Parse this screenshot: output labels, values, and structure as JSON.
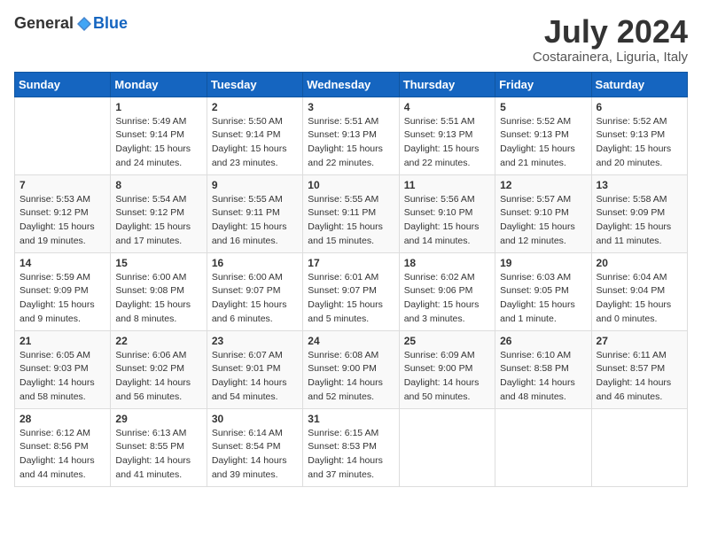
{
  "header": {
    "logo_general": "General",
    "logo_blue": "Blue",
    "title": "July 2024",
    "location": "Costarainera, Liguria, Italy"
  },
  "days_of_week": [
    "Sunday",
    "Monday",
    "Tuesday",
    "Wednesday",
    "Thursday",
    "Friday",
    "Saturday"
  ],
  "weeks": [
    [
      {
        "day": "",
        "info": ""
      },
      {
        "day": "1",
        "info": "Sunrise: 5:49 AM\nSunset: 9:14 PM\nDaylight: 15 hours\nand 24 minutes."
      },
      {
        "day": "2",
        "info": "Sunrise: 5:50 AM\nSunset: 9:14 PM\nDaylight: 15 hours\nand 23 minutes."
      },
      {
        "day": "3",
        "info": "Sunrise: 5:51 AM\nSunset: 9:13 PM\nDaylight: 15 hours\nand 22 minutes."
      },
      {
        "day": "4",
        "info": "Sunrise: 5:51 AM\nSunset: 9:13 PM\nDaylight: 15 hours\nand 22 minutes."
      },
      {
        "day": "5",
        "info": "Sunrise: 5:52 AM\nSunset: 9:13 PM\nDaylight: 15 hours\nand 21 minutes."
      },
      {
        "day": "6",
        "info": "Sunrise: 5:52 AM\nSunset: 9:13 PM\nDaylight: 15 hours\nand 20 minutes."
      }
    ],
    [
      {
        "day": "7",
        "info": "Sunrise: 5:53 AM\nSunset: 9:12 PM\nDaylight: 15 hours\nand 19 minutes."
      },
      {
        "day": "8",
        "info": "Sunrise: 5:54 AM\nSunset: 9:12 PM\nDaylight: 15 hours\nand 17 minutes."
      },
      {
        "day": "9",
        "info": "Sunrise: 5:55 AM\nSunset: 9:11 PM\nDaylight: 15 hours\nand 16 minutes."
      },
      {
        "day": "10",
        "info": "Sunrise: 5:55 AM\nSunset: 9:11 PM\nDaylight: 15 hours\nand 15 minutes."
      },
      {
        "day": "11",
        "info": "Sunrise: 5:56 AM\nSunset: 9:10 PM\nDaylight: 15 hours\nand 14 minutes."
      },
      {
        "day": "12",
        "info": "Sunrise: 5:57 AM\nSunset: 9:10 PM\nDaylight: 15 hours\nand 12 minutes."
      },
      {
        "day": "13",
        "info": "Sunrise: 5:58 AM\nSunset: 9:09 PM\nDaylight: 15 hours\nand 11 minutes."
      }
    ],
    [
      {
        "day": "14",
        "info": "Sunrise: 5:59 AM\nSunset: 9:09 PM\nDaylight: 15 hours\nand 9 minutes."
      },
      {
        "day": "15",
        "info": "Sunrise: 6:00 AM\nSunset: 9:08 PM\nDaylight: 15 hours\nand 8 minutes."
      },
      {
        "day": "16",
        "info": "Sunrise: 6:00 AM\nSunset: 9:07 PM\nDaylight: 15 hours\nand 6 minutes."
      },
      {
        "day": "17",
        "info": "Sunrise: 6:01 AM\nSunset: 9:07 PM\nDaylight: 15 hours\nand 5 minutes."
      },
      {
        "day": "18",
        "info": "Sunrise: 6:02 AM\nSunset: 9:06 PM\nDaylight: 15 hours\nand 3 minutes."
      },
      {
        "day": "19",
        "info": "Sunrise: 6:03 AM\nSunset: 9:05 PM\nDaylight: 15 hours\nand 1 minute."
      },
      {
        "day": "20",
        "info": "Sunrise: 6:04 AM\nSunset: 9:04 PM\nDaylight: 15 hours\nand 0 minutes."
      }
    ],
    [
      {
        "day": "21",
        "info": "Sunrise: 6:05 AM\nSunset: 9:03 PM\nDaylight: 14 hours\nand 58 minutes."
      },
      {
        "day": "22",
        "info": "Sunrise: 6:06 AM\nSunset: 9:02 PM\nDaylight: 14 hours\nand 56 minutes."
      },
      {
        "day": "23",
        "info": "Sunrise: 6:07 AM\nSunset: 9:01 PM\nDaylight: 14 hours\nand 54 minutes."
      },
      {
        "day": "24",
        "info": "Sunrise: 6:08 AM\nSunset: 9:00 PM\nDaylight: 14 hours\nand 52 minutes."
      },
      {
        "day": "25",
        "info": "Sunrise: 6:09 AM\nSunset: 9:00 PM\nDaylight: 14 hours\nand 50 minutes."
      },
      {
        "day": "26",
        "info": "Sunrise: 6:10 AM\nSunset: 8:58 PM\nDaylight: 14 hours\nand 48 minutes."
      },
      {
        "day": "27",
        "info": "Sunrise: 6:11 AM\nSunset: 8:57 PM\nDaylight: 14 hours\nand 46 minutes."
      }
    ],
    [
      {
        "day": "28",
        "info": "Sunrise: 6:12 AM\nSunset: 8:56 PM\nDaylight: 14 hours\nand 44 minutes."
      },
      {
        "day": "29",
        "info": "Sunrise: 6:13 AM\nSunset: 8:55 PM\nDaylight: 14 hours\nand 41 minutes."
      },
      {
        "day": "30",
        "info": "Sunrise: 6:14 AM\nSunset: 8:54 PM\nDaylight: 14 hours\nand 39 minutes."
      },
      {
        "day": "31",
        "info": "Sunrise: 6:15 AM\nSunset: 8:53 PM\nDaylight: 14 hours\nand 37 minutes."
      },
      {
        "day": "",
        "info": ""
      },
      {
        "day": "",
        "info": ""
      },
      {
        "day": "",
        "info": ""
      }
    ]
  ]
}
